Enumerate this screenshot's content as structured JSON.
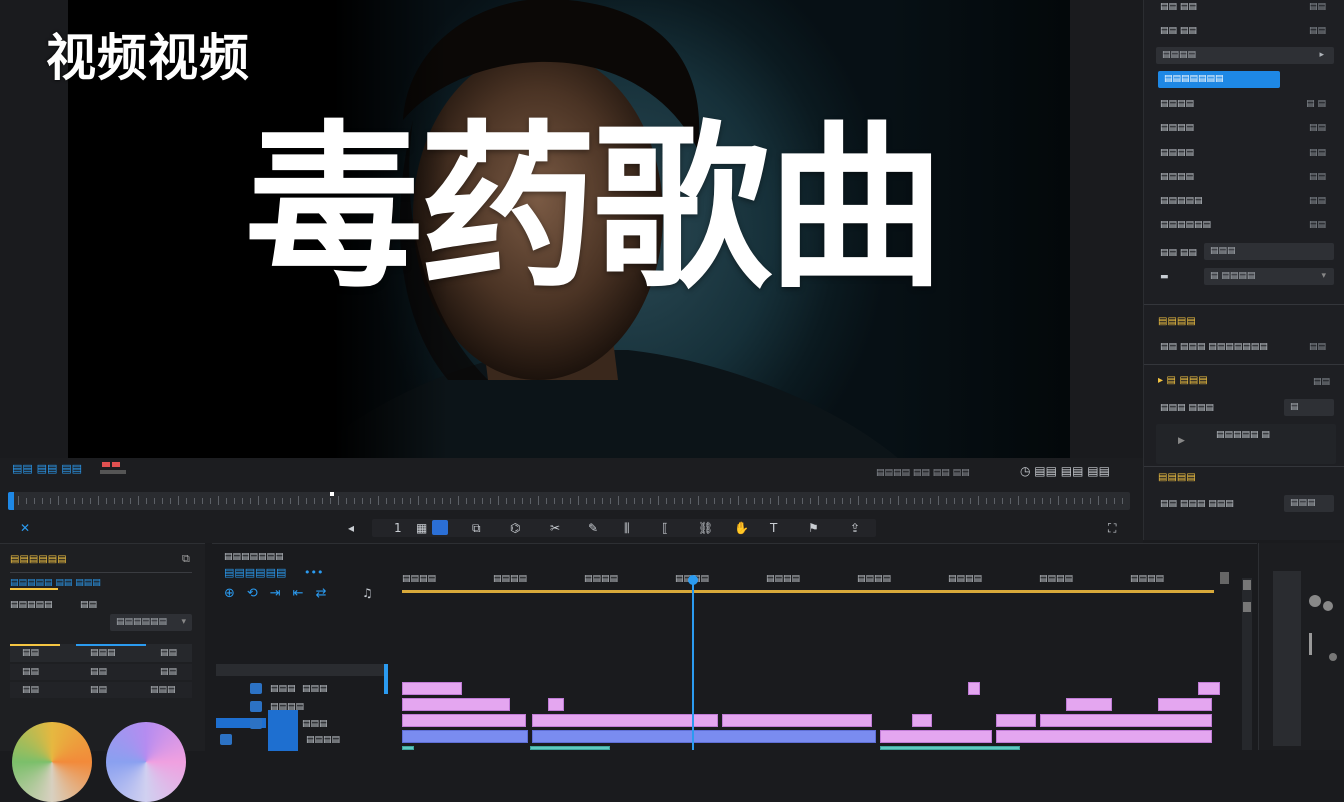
{
  "overlay": {
    "top_left_title": "视频视频",
    "main_title": "毒药歌曲"
  },
  "right_panel": {
    "rows": [
      {
        "label": "▤▤ ▤▤",
        "value": "▤▤"
      },
      {
        "label": "▤▤ ▤▤",
        "value": "▤▤"
      },
      {
        "label": "▤▤▤▤",
        "value": "▸"
      },
      {
        "label": "▤▤▤▤▤▤▤",
        "value": ""
      },
      {
        "label": "▤▤▤▤",
        "value": "▤ ▤"
      },
      {
        "label": "▤▤▤▤",
        "value": "▤▤"
      },
      {
        "label": "▤▤▤▤",
        "value": "▤▤"
      },
      {
        "label": "▤▤▤▤",
        "value": "▤▤"
      },
      {
        "label": "▤▤▤▤▤",
        "value": "▤▤"
      },
      {
        "label": "▤▤▤▤▤▤",
        "value": "▤▤"
      }
    ],
    "field_row_1": {
      "label": "▤▤ ▤▤",
      "value": "▤▤▤"
    },
    "field_row_2": {
      "label": "▬",
      "value": "▤ ▤▤▤▤"
    },
    "section_1": {
      "title": "▤▤▤▤",
      "row": "▤▤ ▤▤▤  ▤▤▤▤▤▤▤",
      "row_value": "▤▤"
    },
    "section_2": {
      "title": "▤ ▤▤▤",
      "value": "▤▤"
    },
    "section_2_row": {
      "label": "▤▤▤  ▤▤▤",
      "value": "▤"
    },
    "section_2_sub": "▤▤▤▤▤ ▤",
    "section_3": {
      "title": "▤▤▤▤",
      "row": "▤▤ ▤▤▤ ▤▤▤",
      "button": "▤▤▤"
    }
  },
  "transport": {
    "left_labels": "▤▤ ▤▤ ▤▤",
    "timecode": "▤▤▤▤ ▤▤ ▤▤ ▤▤",
    "right_icons": "◷ ▤▤ ▤▤ ▤▤",
    "zoom": "1"
  },
  "left_panel": {
    "title": "▤▤▤▤▤▤",
    "sub": "▤▤▤▤▤ ▤▤ ▤▤▤",
    "row1_label": "▤▤▤▤▤",
    "row1_value": "▤▤",
    "dropdown": "▤▤▤▤▤▤",
    "table_headers": [
      "▤▤",
      "▤▤▤",
      "▤▤"
    ],
    "table_rows": [
      [
        "▤▤",
        "▤▤",
        "▤▤"
      ],
      [
        "▤▤",
        "▤▤",
        "▤▤▤"
      ]
    ]
  },
  "timeline": {
    "header_small": "▤▤▤▤▤▤▤",
    "header_main": "▤▤▤▤▤▤",
    "ruler_labels": [
      "▤▤▤▤",
      "▤▤▤▤",
      "▤▤▤▤",
      "▤▤▤▤",
      "▤▤▤▤",
      "▤▤▤▤",
      "▤▤▤▤",
      "▤▤▤▤",
      "▤▤▤▤"
    ],
    "tracks": [
      {
        "name": "▤▤▤",
        "extra": "▤▤▤"
      },
      {
        "name": "▤▤▤▤",
        "extra": ""
      },
      {
        "name": "▤▤▤",
        "extra": ""
      },
      {
        "name": "▤▤▤▤",
        "extra": ""
      }
    ]
  },
  "colors": {
    "accent_blue": "#1e88e5",
    "clip_pink": "#e4a6f0",
    "clip_blue": "#7a8cf0",
    "clip_teal": "#5fc9c0",
    "ruler_gold": "#d8a93a",
    "section_yellow": "#f5c542"
  }
}
